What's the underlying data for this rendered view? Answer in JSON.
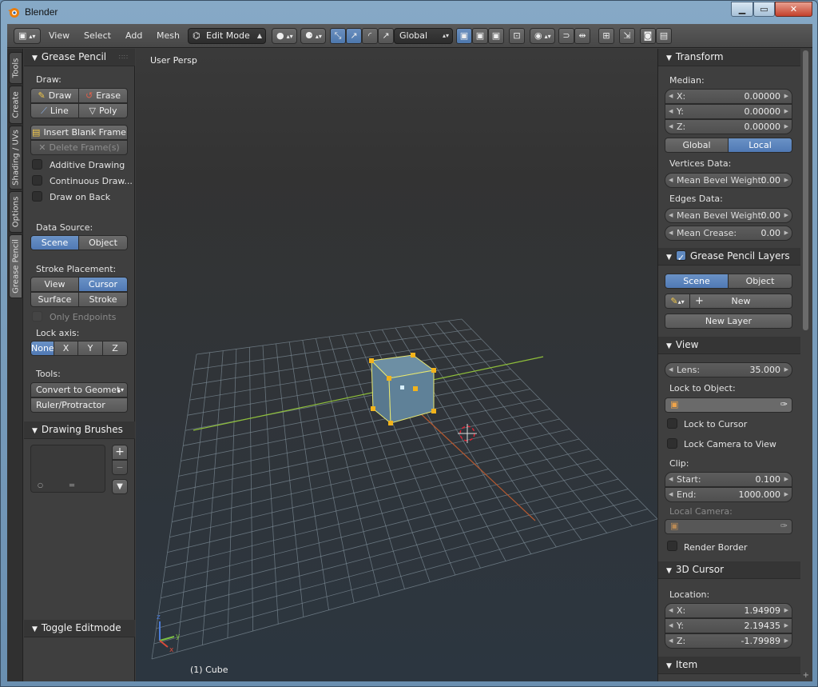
{
  "window": {
    "title": "Blender"
  },
  "header": {
    "menus": [
      "View",
      "Select",
      "Add",
      "Mesh"
    ],
    "mode": "Edit Mode",
    "orientation": "Global"
  },
  "tabs": [
    "Tools",
    "Create",
    "Shading / UVs",
    "Options",
    "Grease Pencil"
  ],
  "grease_pencil": {
    "title": "Grease Pencil",
    "draw_label": "Draw:",
    "draw": "Draw",
    "erase": "Erase",
    "line": "Line",
    "poly": "Poly",
    "insert_blank_frame": "Insert Blank Frame",
    "delete_frames": "Delete Frame(s)",
    "additive_drawing": "Additive Drawing",
    "continuous_drawing": "Continuous Draw...",
    "draw_on_back": "Draw on Back",
    "data_source_label": "Data Source:",
    "scene": "Scene",
    "object": "Object",
    "stroke_placement_label": "Stroke Placement:",
    "view": "View",
    "cursor": "Cursor",
    "surface": "Surface",
    "stroke": "Stroke",
    "only_endpoints": "Only Endpoints",
    "lock_axis_label": "Lock axis:",
    "none": "None",
    "x": "X",
    "y": "Y",
    "z": "Z",
    "tools_label": "Tools:",
    "convert": "Convert to Geomet",
    "ruler": "Ruler/Protractor"
  },
  "drawing_brushes": {
    "title": "Drawing Brushes"
  },
  "toggle_editmode": {
    "title": "Toggle Editmode"
  },
  "viewport": {
    "label": "User Persp",
    "object": "(1) Cube",
    "axis_x": "x",
    "axis_y": "y",
    "axis_z": "z"
  },
  "transform": {
    "title": "Transform",
    "median_label": "Median:",
    "x_label": "X:",
    "x": "0.00000",
    "y_label": "Y:",
    "y": "0.00000",
    "z_label": "Z:",
    "z": "0.00000",
    "global": "Global",
    "local": "Local",
    "vertices_data_label": "Vertices Data:",
    "mean_bevel_weight_label": "Mean Bevel Weight:",
    "vertex_bevel": "0.00",
    "edges_data_label": "Edges Data:",
    "edge_bevel": "0.00",
    "mean_crease_label": "Mean Crease:",
    "mean_crease": "0.00"
  },
  "gp_layers": {
    "title": "Grease Pencil Layers",
    "scene": "Scene",
    "object": "Object",
    "new": "New",
    "new_layer": "New Layer"
  },
  "view_panel": {
    "title": "View",
    "lens_label": "Lens:",
    "lens": "35.000",
    "lock_to_object_label": "Lock to Object:",
    "lock_to_cursor": "Lock to Cursor",
    "lock_camera_to_view": "Lock Camera to View",
    "clip_label": "Clip:",
    "start_label": "Start:",
    "start": "0.100",
    "end_label": "End:",
    "end": "1000.000",
    "local_camera_label": "Local Camera:",
    "render_border": "Render Border"
  },
  "cursor_panel": {
    "title": "3D Cursor",
    "location_label": "Location:",
    "x_label": "X:",
    "x": "1.94909",
    "y_label": "Y:",
    "y": "2.19435",
    "z_label": "Z:",
    "z": "-1.79989"
  },
  "item_panel": {
    "title": "Item"
  },
  "colors": {
    "accent": "#5a85bd",
    "panel": "#3f3f3f",
    "header": "#353535",
    "selection": "#f2b31b"
  }
}
